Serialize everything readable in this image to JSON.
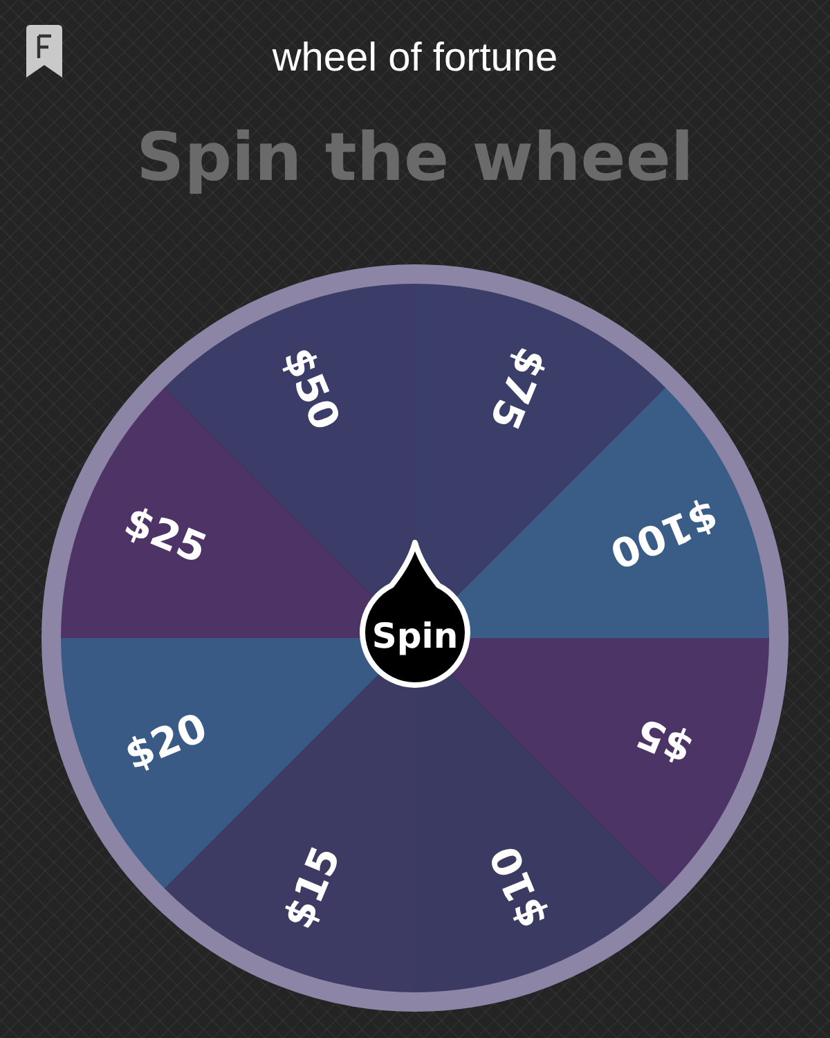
{
  "title": "wheel of fortune",
  "heading": "Spin the wheel",
  "spin_button": {
    "label": "Spin"
  },
  "segments": [
    {
      "label": "$75",
      "color": "#3a3e68"
    },
    {
      "label": "$100",
      "color": "#3a5d87"
    },
    {
      "label": "$5",
      "color": "#4c3466"
    },
    {
      "label": "$10",
      "color": "#3b3a62"
    },
    {
      "label": "$15",
      "color": "#3d3b64"
    },
    {
      "label": "$20",
      "color": "#3a5a86"
    },
    {
      "label": "$25",
      "color": "#4e3367"
    },
    {
      "label": "$50",
      "color": "#3c3c68"
    }
  ]
}
